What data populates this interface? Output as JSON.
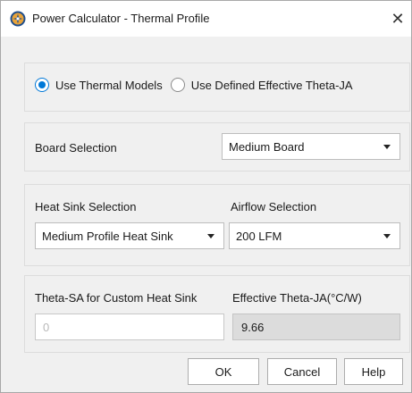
{
  "window": {
    "title": "Power Calculator - Thermal Profile",
    "close_glyph": "✕",
    "app_icon": "power-calculator-icon"
  },
  "theta_mode": {
    "options": [
      {
        "label": "Use Thermal Models",
        "checked": true
      },
      {
        "label": "Use Defined Effective Theta-JA",
        "checked": false
      }
    ]
  },
  "board": {
    "label": "Board Selection",
    "selected": "Medium Board"
  },
  "heat_sink": {
    "label": "Heat Sink Selection",
    "selected": "Medium Profile Heat Sink"
  },
  "airflow": {
    "label": "Airflow Selection",
    "selected": "200 LFM"
  },
  "custom_theta_sa": {
    "label": "Theta-SA for Custom Heat Sink",
    "placeholder": "0"
  },
  "effective_theta_ja": {
    "label": "Effective Theta-JA(°C/W)",
    "value": "9.66"
  },
  "buttons": {
    "ok": "OK",
    "cancel": "Cancel",
    "help": "Help"
  },
  "colors": {
    "accent": "#0078d7",
    "icon_orange": "#e8a33a",
    "icon_blue": "#1f4e8c"
  }
}
